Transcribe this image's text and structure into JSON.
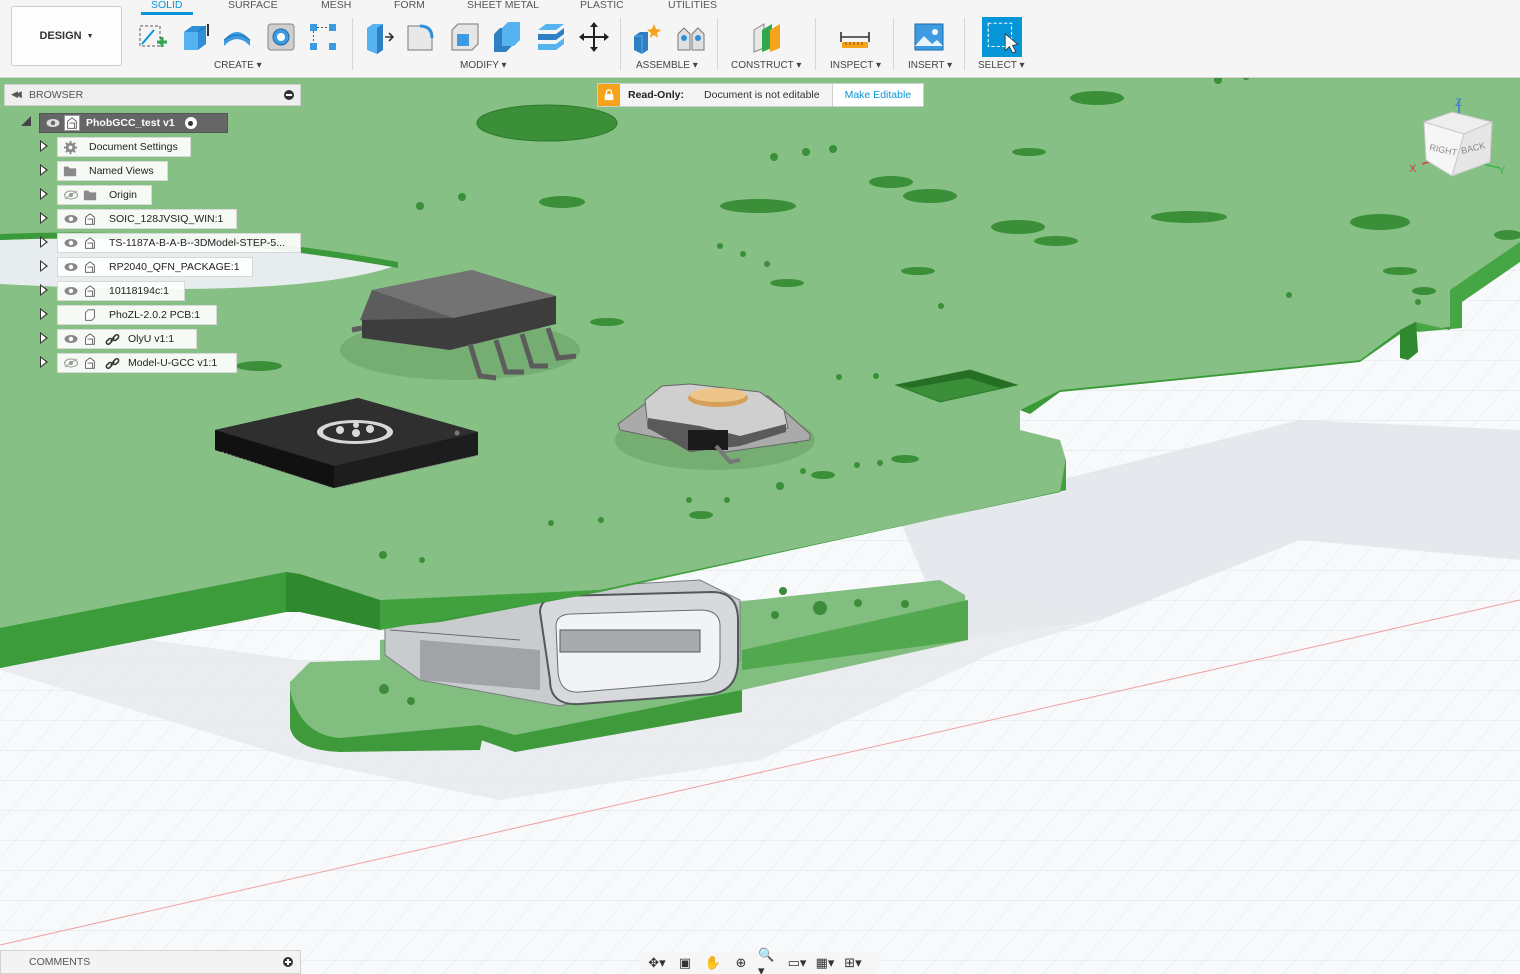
{
  "workspace": {
    "label": "DESIGN"
  },
  "tabs": [
    "SOLID",
    "SURFACE",
    "MESH",
    "FORM",
    "SHEET METAL",
    "PLASTIC",
    "UTILITIES"
  ],
  "groups": {
    "create": "CREATE",
    "modify": "MODIFY",
    "assemble": "ASSEMBLE",
    "construct": "CONSTRUCT",
    "inspect": "INSPECT",
    "insert": "INSERT",
    "select": "SELECT"
  },
  "browser": {
    "title": "BROWSER",
    "root": "PhobGCC_test v1",
    "items": [
      "Document Settings",
      "Named Views",
      "Origin",
      "SOIC_128JVSIQ_WIN:1",
      "TS-1187A-B-A-B--3DModel-STEP-5...",
      "RP2040_QFN_PACKAGE:1",
      "10118194c:1",
      "PhoZL-2.0.2 PCB:1",
      "OlyU v1:1",
      "Model-U-GCC v1:1"
    ]
  },
  "readonly": {
    "label": "Read-Only:",
    "message": "Document is not editable",
    "action": "Make Editable"
  },
  "viewcube": {
    "axis_z": "Z",
    "axis_x": "X",
    "axis_y": "Y",
    "face_right": "RIGHT",
    "face_back": "BACK"
  },
  "comments": {
    "title": "COMMENTS"
  },
  "colors": {
    "accent": "#0696d7",
    "pcb": "#86c084",
    "pcb_edge": "#3a9a3a",
    "lock": "#f7a21b"
  }
}
